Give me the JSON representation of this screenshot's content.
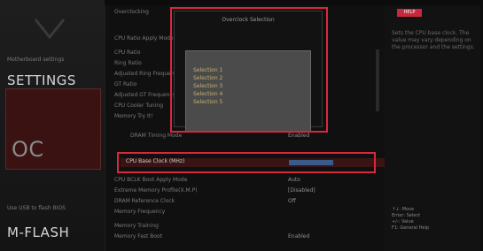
{
  "sidebar": {
    "settings_sub": "Motherboard settings",
    "settings_title": "SETTINGS",
    "oc_title": "OC",
    "mflash_sub": "Use USB to flash BIOS",
    "mflash_title": "M-FLASH"
  },
  "header": {
    "breadcrumb": "Overclocking"
  },
  "rows": [
    {
      "label": "CPU Ratio Apply Mode",
      "value": ""
    },
    {
      "label": "CPU Ratio",
      "value": ""
    },
    {
      "label": "Ring Ratio",
      "value": ""
    },
    {
      "label": "Adjusted Ring Frequency",
      "value": ""
    },
    {
      "label": "GT Ratio",
      "value": ""
    },
    {
      "label": "Adjusted GT Frequency",
      "value": ""
    },
    {
      "label": "CPU Cooler Tuning",
      "value": ""
    },
    {
      "label": "Memory Try It!",
      "value": ""
    },
    {
      "label": "DRAM Timing Mode",
      "value": "Enabled"
    }
  ],
  "highlight_row": {
    "label": "CPU Base Clock (MHz)",
    "value": ""
  },
  "lower_rows": [
    {
      "label": "CPU BCLK Boot Apply Mode",
      "value": "Auto"
    },
    {
      "label": "Extreme Memory Profile(X.M.P)",
      "value": "[Disabled]"
    },
    {
      "label": "DRAM Reference Clock",
      "value": "Off"
    },
    {
      "label": "Memory Frequency",
      "value": ""
    },
    {
      "label": "Memory Training",
      "value": ""
    },
    {
      "label": "Memory Fast Boot",
      "value": "Enabled"
    }
  ],
  "popup": {
    "title": "Overclock Selection",
    "options": [
      "Selection 1",
      "Selection 2",
      "Selection 3",
      "Selection 4",
      "Selection 5"
    ]
  },
  "help": {
    "tab": "HELP",
    "text": "Sets the CPU base clock. The value may vary depending on the processor and the settings.",
    "keys": [
      "↑↓: Move",
      "Enter: Select",
      "+/-: Value",
      "F1: General Help"
    ]
  },
  "colors": {
    "accent": "#d8283c",
    "highlight": "#3a1414"
  }
}
